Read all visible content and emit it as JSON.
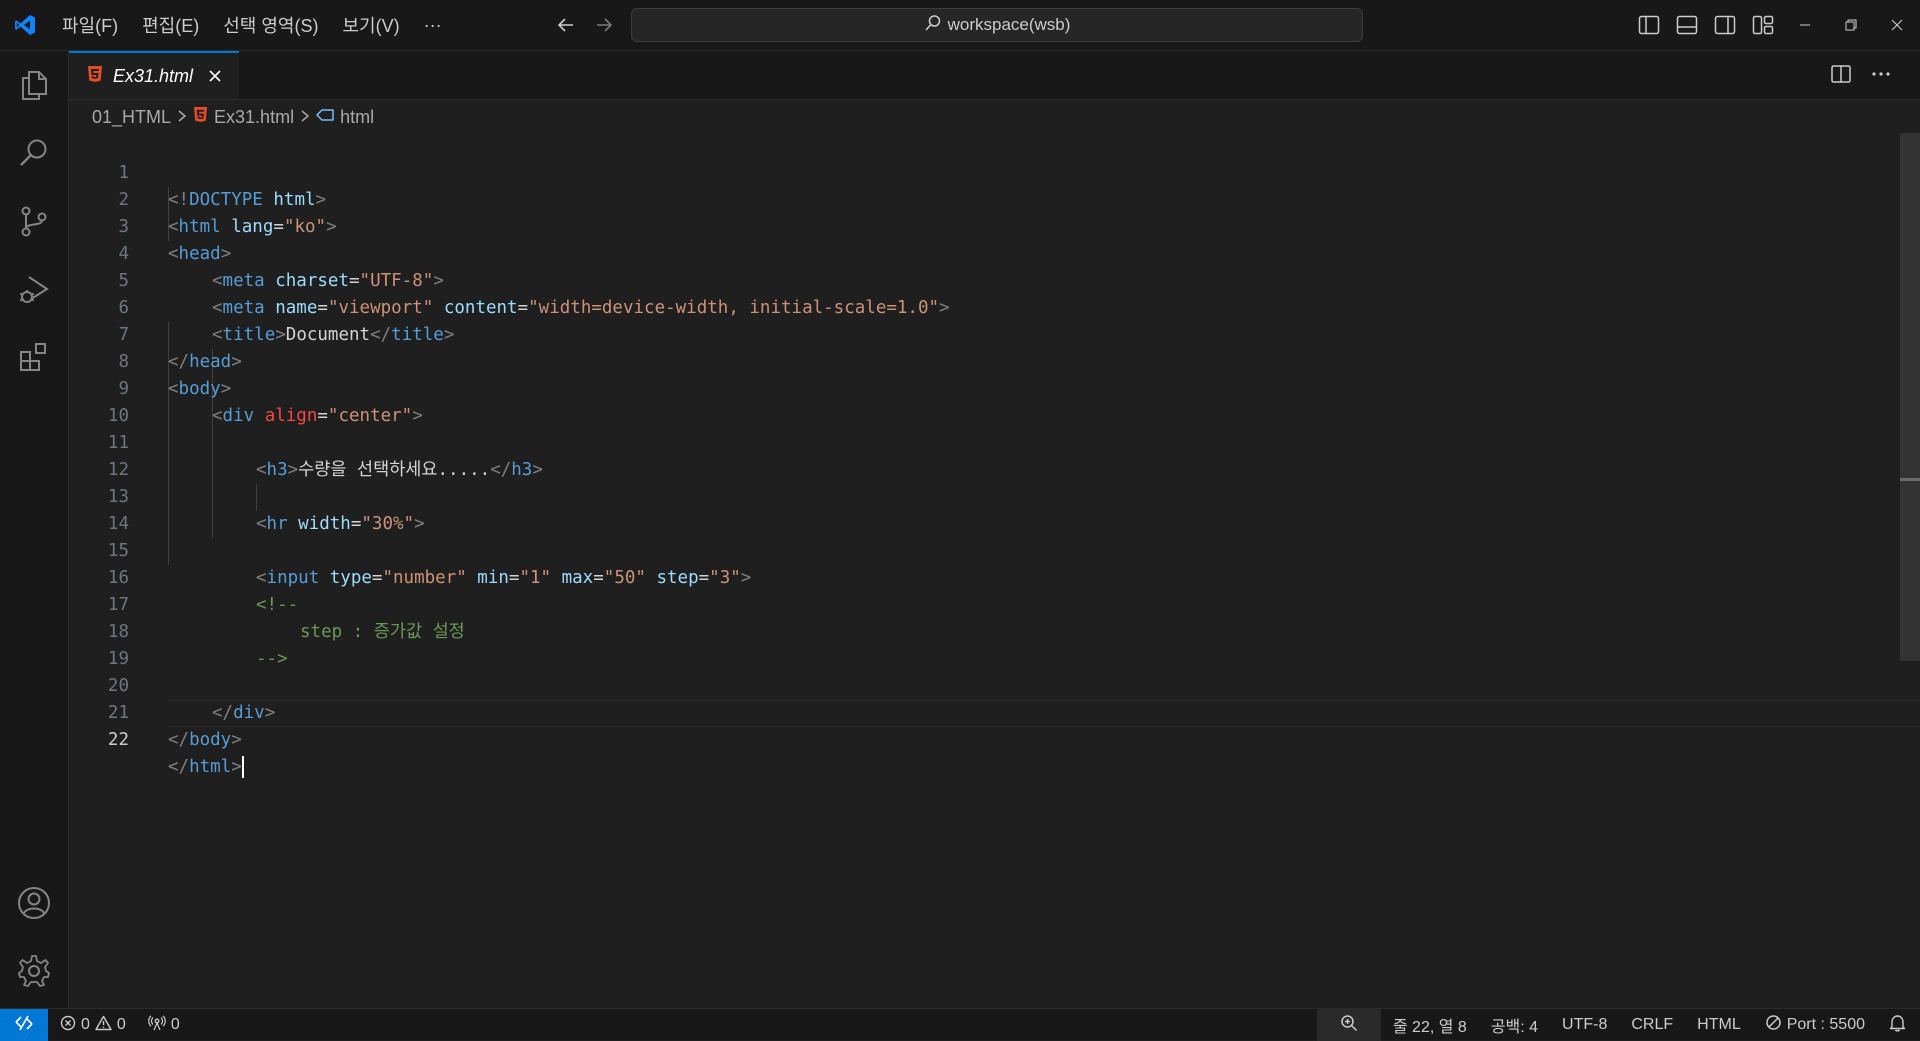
{
  "titlebar": {
    "menu": [
      "파일(F)",
      "편집(E)",
      "선택 영역(S)",
      "보기(V)",
      "···"
    ],
    "search": "workspace(wsb)"
  },
  "colors": {
    "accent": "#0078d4",
    "html_icon": "#e44d26",
    "background": "#1f1f1f"
  },
  "tab": {
    "label": "Ex31.html"
  },
  "breadcrumb": [
    "01_HTML",
    "Ex31.html",
    "html"
  ],
  "editor": {
    "lines": [
      {
        "n": "1"
      },
      {
        "n": "2"
      },
      {
        "n": "3"
      },
      {
        "n": "4"
      },
      {
        "n": "5"
      },
      {
        "n": "6"
      },
      {
        "n": "7"
      },
      {
        "n": "8"
      },
      {
        "n": "9"
      },
      {
        "n": "10"
      },
      {
        "n": "11"
      },
      {
        "n": "12"
      },
      {
        "n": "13"
      },
      {
        "n": "14"
      },
      {
        "n": "15"
      },
      {
        "n": "16"
      },
      {
        "n": "17"
      },
      {
        "n": "18"
      },
      {
        "n": "19"
      },
      {
        "n": "20"
      },
      {
        "n": "21"
      },
      {
        "n": "22"
      }
    ],
    "active_line": "22",
    "tokens": {
      "l1_a": "<!",
      "l1_b": "DOCTYPE",
      "l1_c": " html",
      "l1_d": ">",
      "l2_a": "<",
      "l2_b": "html",
      "l2_c": " lang",
      "l2_d": "=",
      "l2_e": "\"ko\"",
      "l2_f": ">",
      "l3_a": "<",
      "l3_b": "head",
      "l3_c": ">",
      "l4_a": "<",
      "l4_b": "meta",
      "l4_c": " charset",
      "l4_d": "=",
      "l4_e": "\"UTF-8\"",
      "l4_f": ">",
      "l5_a": "<",
      "l5_b": "meta",
      "l5_c": " name",
      "l5_d": "=",
      "l5_e": "\"viewport\"",
      "l5_f": " content",
      "l5_g": "=",
      "l5_h": "\"width=device-width, initial-scale=1.0\"",
      "l5_i": ">",
      "l6_a": "<",
      "l6_b": "title",
      "l6_c": ">",
      "l6_d": "Document",
      "l6_e": "</",
      "l6_f": "title",
      "l6_g": ">",
      "l7_a": "</",
      "l7_b": "head",
      "l7_c": ">",
      "l8_a": "<",
      "l8_b": "body",
      "l8_c": ">",
      "l9_a": "<",
      "l9_b": "div",
      "l9_c": " align",
      "l9_d": "=",
      "l9_e": "\"center\"",
      "l9_f": ">",
      "l11_a": "<",
      "l11_b": "h3",
      "l11_c": ">",
      "l11_d": "수량을 선택하세요.....",
      "l11_e": "</",
      "l11_f": "h3",
      "l11_g": ">",
      "l13_a": "<",
      "l13_b": "hr",
      "l13_c": " width",
      "l13_d": "=",
      "l13_e": "\"30%\"",
      "l13_f": ">",
      "l15_a": "<",
      "l15_b": "input",
      "l15_c": " type",
      "l15_d": "=",
      "l15_e": "\"number\"",
      "l15_f": " min",
      "l15_g": "=",
      "l15_h": "\"1\"",
      "l15_i": " max",
      "l15_j": "=",
      "l15_k": "\"50\"",
      "l15_l": " step",
      "l15_m": "=",
      "l15_n": "\"3\"",
      "l15_o": ">",
      "l16": "<!--",
      "l17": "step : 증가값 설정",
      "l18": "-->",
      "l20_a": "</",
      "l20_b": "div",
      "l20_c": ">",
      "l21_a": "</",
      "l21_b": "body",
      "l21_c": ">",
      "l22_a": "</",
      "l22_b": "html",
      "l22_c": ">"
    }
  },
  "status": {
    "errors": "0",
    "warnings": "0",
    "ports": "0",
    "position": "줄 22, 열 8",
    "indent": "공백: 4",
    "encoding": "UTF-8",
    "eol": "CRLF",
    "language": "HTML",
    "live_server": "Port : 5500"
  }
}
